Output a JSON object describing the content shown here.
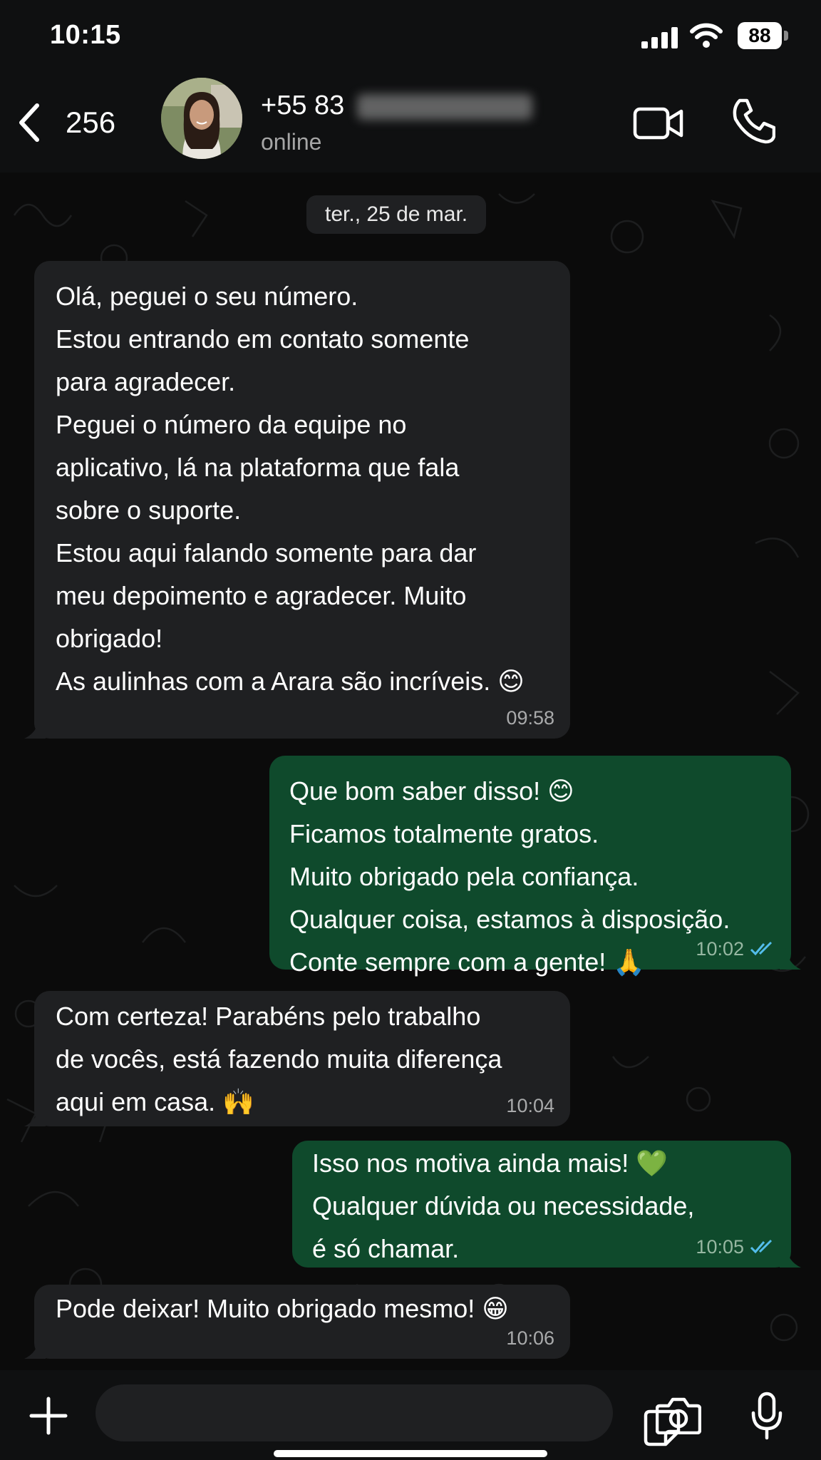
{
  "status_bar": {
    "time": "10:15",
    "battery": "88"
  },
  "header": {
    "back_count": "256",
    "contact_name": "+55 83",
    "contact_status": "online"
  },
  "chat": {
    "date_chip": "ter., 25 de mar.",
    "messages": [
      {
        "direction": "incoming",
        "text": "Olá, peguei o seu número.\nEstou entrando em contato somente\npara agradecer.\nPeguei o número da equipe no\naplicativo, lá na plataforma que fala\nsobre o suporte.\nEstou aqui falando somente para dar\nmeu depoimento e agradecer. Muito\nobrigado!\nAs aulinhas com a Arara são incríveis. 😊",
        "time": "09:58"
      },
      {
        "direction": "outgoing",
        "text": "Que bom saber disso! 😊\nFicamos totalmente gratos.\nMuito obrigado pela confiança.\nQualquer coisa, estamos à disposição.\nConte sempre com a gente! 🙏",
        "time": "10:02",
        "read": true
      },
      {
        "direction": "incoming",
        "text": "Com certeza! Parabéns pelo trabalho\nde vocês, está fazendo muita diferença\naqui em casa. 🙌",
        "time": "10:04"
      },
      {
        "direction": "outgoing",
        "text": "Isso nos motiva ainda mais! 💚\nQualquer dúvida ou necessidade,\né só chamar.",
        "time": "10:05",
        "read": true
      },
      {
        "direction": "incoming",
        "text": "Pode deixar! Muito obrigado mesmo! 😁",
        "time": "10:06"
      }
    ]
  },
  "colors": {
    "incoming_bubble": "#1f2022",
    "outgoing_bubble": "#0f4a2c",
    "read_ticks": "#53bdeb",
    "background": "#0b0b0b"
  },
  "icons": [
    "chevron-left-icon",
    "video-camera-icon",
    "phone-icon",
    "plus-icon",
    "sticker-icon",
    "camera-icon",
    "microphone-icon"
  ]
}
